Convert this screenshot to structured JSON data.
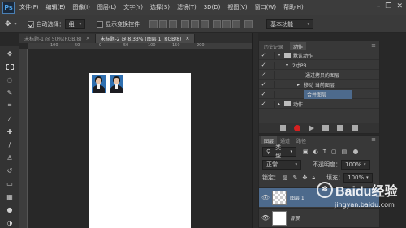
{
  "app": {
    "logo": "Ps"
  },
  "menu": [
    "文件(F)",
    "编辑(E)",
    "图像(I)",
    "图层(L)",
    "文字(Y)",
    "选择(S)",
    "滤镜(T)",
    "3D(D)",
    "视图(V)",
    "窗口(W)",
    "帮助(H)"
  ],
  "window_controls": {
    "minimize": "–",
    "restore": "❐",
    "close": "✕"
  },
  "options": {
    "auto_select_label": "自动选择：",
    "auto_select_value": "组",
    "show_transform_label": "显示变换控件",
    "workspace_value": "基本功能"
  },
  "tabs": [
    {
      "label": "未标题-1 @ 50%(RGB/8)",
      "close": "×"
    },
    {
      "label": "未标题-2 @ 8.33% (图层 1, RGB/8)",
      "close": "×"
    }
  ],
  "ruler": {
    "marks": [
      "100",
      "50",
      "0",
      "50",
      "100",
      "150",
      "200"
    ]
  },
  "actions_panel": {
    "tabs": [
      "历史记录",
      "动作"
    ],
    "rows": [
      {
        "check": "✓",
        "arrow": "▾",
        "label": "默认动作",
        "is_folder": true
      },
      {
        "check": "✓",
        "arrow": "▾",
        "label": "2寸PB",
        "is_folder": false
      },
      {
        "check": "✓",
        "arrow": "",
        "label": "通过拷贝的图层",
        "is_folder": false
      },
      {
        "check": "✓",
        "arrow": "▸",
        "label": "移动 当前图层",
        "is_folder": false
      },
      {
        "check": "✓",
        "arrow": "",
        "label": "合并图层",
        "is_folder": false,
        "selected": true
      },
      {
        "check": "✓",
        "arrow": "▸",
        "label": "动作",
        "is_folder": true
      }
    ]
  },
  "layers_panel": {
    "tabs": [
      "图层",
      "通道",
      "路径"
    ],
    "kind_label": "类型",
    "blend_mode": "正常",
    "opacity_label": "不透明度：",
    "opacity_value": "100%",
    "lock_label": "锁定：",
    "fill_label": "填充：",
    "fill_value": "100%",
    "layers": [
      {
        "name": "图层 1",
        "thumb": "check",
        "selected": true
      },
      {
        "name": "背景",
        "thumb": "white",
        "selected": false
      }
    ]
  },
  "watermark": {
    "brand": "Baidu经验",
    "url": "jingyan.baidu.com"
  },
  "colors": {
    "accent": "#4d6a8c",
    "photo_bg": "#2f6fb0",
    "record_red": "#d62020"
  }
}
